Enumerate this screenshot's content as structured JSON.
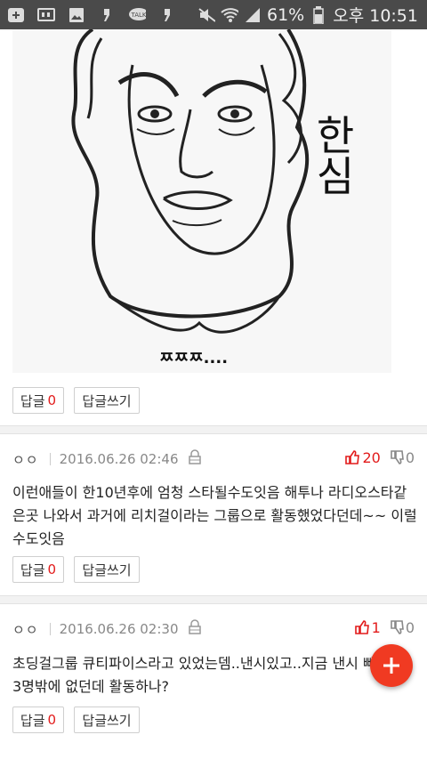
{
  "status_bar": {
    "battery": "61%",
    "time": "오후 10:51",
    "icons": [
      "add-icon",
      "gallery-icon",
      "image-icon",
      "notification-icon",
      "kakaotalk-icon",
      "notification-icon",
      "mute-icon",
      "wifi-icon",
      "signal-icon",
      "battery-icon"
    ]
  },
  "post_image": {
    "text_right": "한심",
    "text_bottom": "ㅉㅉㅉ...."
  },
  "first_actions": {
    "reply_label": "답글",
    "reply_count": "0",
    "write_reply_label": "답글쓰기"
  },
  "comments": [
    {
      "nickname": "ㅇㅇ",
      "date": "2016.06.26 02:46",
      "upvotes": "20",
      "downvotes": "0",
      "text": "이런애들이 한10년후에 엄청 스타될수도잇음 해투나 라디오스타같은곳 나와서 과거에 리치걸이라는 그룹으로 활동했었다던데~~ 이럴수도잇음",
      "reply_label": "답글",
      "reply_count": "0",
      "write_reply_label": "답글쓰기"
    },
    {
      "nickname": "ㅇㅇ",
      "date": "2016.06.26 02:30",
      "upvotes": "1",
      "downvotes": "0",
      "text": "초딩걸그룹 큐티파이스라고 있었는뎀..낸시있고..지금 낸시 빼고\n3명밖에 없던데 활동하나?",
      "reply_label": "답글",
      "reply_count": "0",
      "write_reply_label": "답글쓰기"
    }
  ],
  "colors": {
    "accent_red": "#e21b1b",
    "fab": "#f03a22",
    "statusbar": "#4a4a4a"
  }
}
